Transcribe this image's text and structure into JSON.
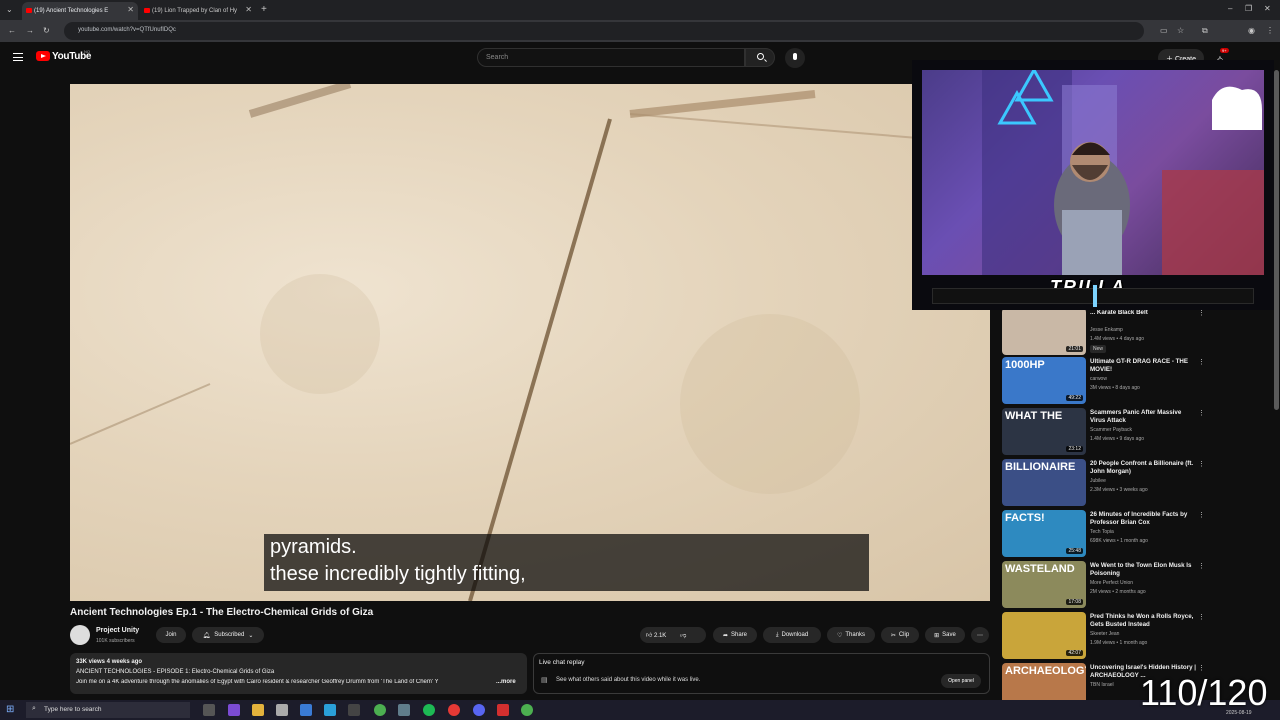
{
  "browser": {
    "tabs": [
      {
        "title": "(19) Ancient Technologies E"
      },
      {
        "title": "(19) Lion Trapped by Clan of Hy"
      }
    ],
    "url": "youtube.com/watch?v=QTfUnufIDQc"
  },
  "header": {
    "logo_text": "YouTube",
    "country_code": "NO",
    "search_placeholder": "Search",
    "create_label": "Create",
    "notification_count": "9+"
  },
  "video": {
    "caption_lines": [
      "pyramids.",
      "these incredibly tightly fitting,"
    ],
    "title": "Ancient Technologies Ep.1 - The Electro-Chemical Grids of Giza"
  },
  "channel": {
    "name": "Project Unity",
    "subscribers": "101K subscribers",
    "join_label": "Join",
    "subscribed_label": "Subscribed"
  },
  "actions": {
    "likes": "2.1K",
    "share": "Share",
    "download": "Download",
    "thanks": "Thanks",
    "clip": "Clip",
    "save": "Save"
  },
  "description": {
    "stats": "33K views  4 weeks ago",
    "line1": "ANCIENT TECHNOLOGIES - EPISODE 1: Electro-Chemical Grids of Giza",
    "line2": "Join me on a 4K adventure through the anomalies of Egypt with Cairo resident & researcher Geoffrey Drumm from 'The Land of Chem' Y",
    "more": "...more"
  },
  "live_chat": {
    "title": "Live chat replay",
    "text": "See what others said about this video while it was live.",
    "open_panel": "Open panel"
  },
  "recommendations": [
    {
      "title": "... Karate Black Belt",
      "channel": "Jesse Enkamp",
      "meta": "1.4M views • 4 days ago",
      "badge": "New",
      "duration": "21:01",
      "thumb_text": "",
      "thumb_color": "#c9b8a6"
    },
    {
      "title": "Ultimate GT-R DRAG RACE - THE MOVIE!",
      "channel": "carwow",
      "meta": "3M views • 8 days ago",
      "badge": "",
      "duration": "49:22",
      "thumb_text": "1000HP",
      "thumb_color": "#3a78c9"
    },
    {
      "title": "Scammers Panic After Massive Virus Attack",
      "channel": "Scammer Payback",
      "meta": "1.4M views • 9 days ago",
      "badge": "",
      "duration": "23:12",
      "thumb_text": "WHAT THE",
      "thumb_color": "#2c3444"
    },
    {
      "title": "20 People Confront a Billionaire (ft. John Morgan)",
      "channel": "Jubilee",
      "meta": "2.3M views • 3 weeks ago",
      "badge": "",
      "duration": "",
      "thumb_text": "BILLIONAIRE",
      "thumb_color": "#3b4f86"
    },
    {
      "title": "26 Minutes of Incredible Facts by Professor Brian Cox",
      "channel": "Tech Topia",
      "meta": "698K views • 1 month ago",
      "badge": "",
      "duration": "25:48",
      "thumb_text": "FACTS!",
      "thumb_color": "#2e8ac0"
    },
    {
      "title": "We Went to the Town Elon Musk Is Poisoning",
      "channel": "More Perfect Union",
      "meta": "2M views • 2 months ago",
      "badge": "",
      "duration": "17:08",
      "thumb_text": "WASTELAND",
      "thumb_color": "#8c8a5c"
    },
    {
      "title": "Pred Thinks he Won a Rolls Royce, Gets Busted Instead",
      "channel": "Skeeter Jean",
      "meta": "1.9M views • 1 month ago",
      "badge": "",
      "duration": "42:07",
      "thumb_text": "",
      "thumb_color": "#c9a53a"
    },
    {
      "title": "Uncovering Israel's Hidden History | ARCHAEOLOGY ...",
      "channel": "TBN Israel",
      "meta": "",
      "badge": "",
      "duration": "",
      "thumb_text": "ARCHAEOLOGY",
      "thumb_color": "#b8784a"
    }
  ],
  "webcam": {
    "streamer_name": "TRILLA"
  },
  "taskbar": {
    "search_placeholder": "Type here to search",
    "date": "2025-08-19"
  },
  "overlay_counter": "110/120"
}
